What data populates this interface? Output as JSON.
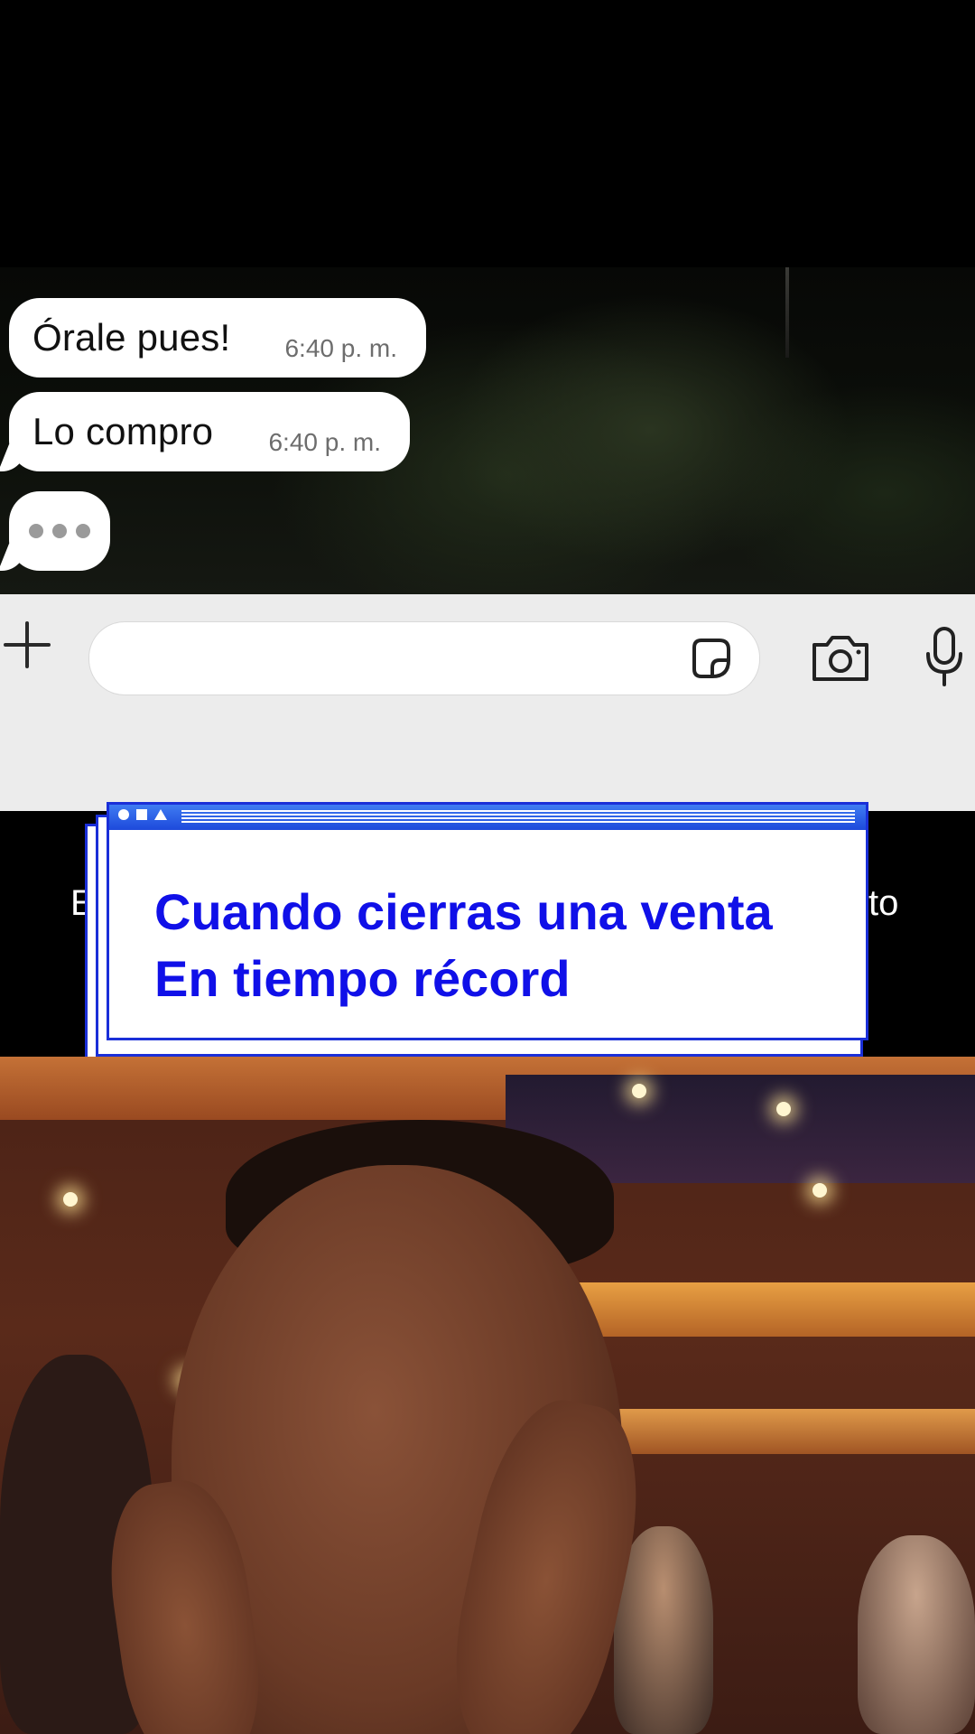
{
  "chat": {
    "messages": [
      {
        "text": "Órale pues!",
        "time": "6:40 p. m."
      },
      {
        "text": "Lo compro",
        "time": "6:40 p. m."
      }
    ],
    "typing_indicator": "typing",
    "input": {
      "placeholder": ""
    },
    "icons": [
      "plus-icon",
      "sticker-icon",
      "camera-icon",
      "microphone-icon"
    ]
  },
  "subtitle_fragments": {
    "left": "E",
    "right": "to"
  },
  "overlay_card": {
    "line1": "Cuando cierras una venta",
    "line2": "En tiempo récord",
    "text_color": "#1010e8",
    "border_color": "#1a2fd8"
  },
  "photo": {
    "description_icon": "reaction-photo"
  }
}
